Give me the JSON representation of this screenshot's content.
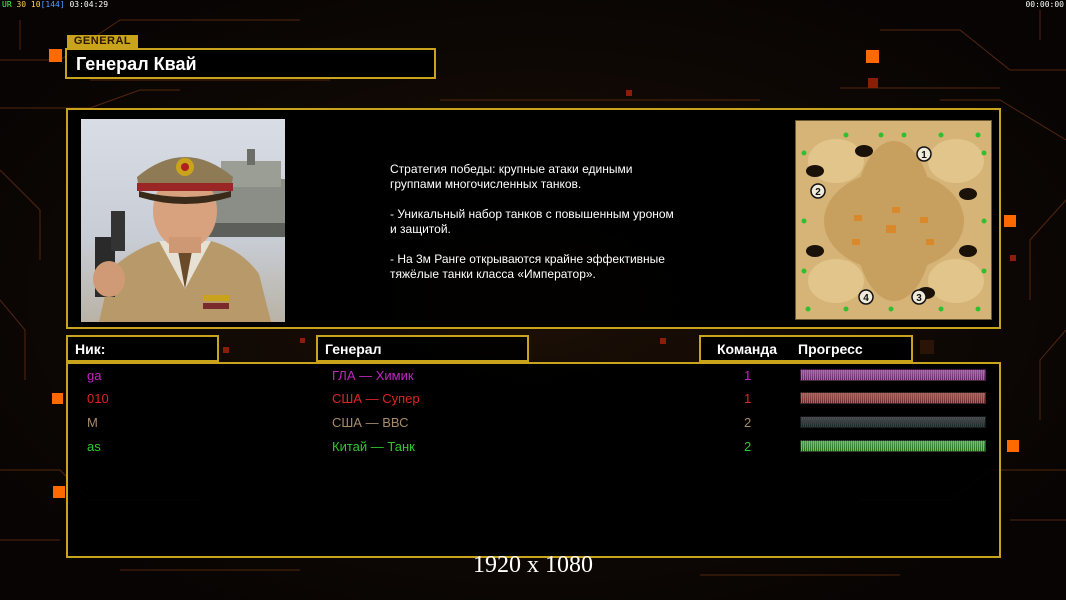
{
  "hud": {
    "fps_label": "UR",
    "fps_values": "30 10",
    "fps_bracket": "[144]",
    "clock": "03:04:29",
    "timer": "00:00:00"
  },
  "general": {
    "tag": "GENERAL",
    "name": "Генерал Квай",
    "description": "Стратегия победы: крупные атаки едиными\n группами многочисленных танков.\n\n- Уникальный набор танков с повышенным уроном\n и защитой.\n\n- На 3м Ранге открываются крайне эффективные\n тяжёлые танки класса «Император»."
  },
  "minimap": {
    "spawns": [
      "1",
      "2",
      "3",
      "4"
    ]
  },
  "headers": {
    "nick": "Ник:",
    "general": "Генерал",
    "team": "Команда",
    "progress": "Прогресс"
  },
  "players": [
    {
      "nick": "ga",
      "general": "ГЛА — Химик",
      "team": "1",
      "color": "#c027c0",
      "progress": 1.0
    },
    {
      "nick": "010",
      "general": "США — Супер",
      "team": "1",
      "color": "#e02424",
      "progress": 1.0
    },
    {
      "nick": "M",
      "general": "США — ВВС",
      "team": "2",
      "color": "#a88a6a",
      "progress": 1.0
    },
    {
      "nick": "as",
      "general": "Китай — Танк",
      "team": "2",
      "color": "#2ec82e",
      "progress": 1.0
    }
  ],
  "bar_colors": [
    "#d44ad4",
    "#e05050",
    "#334444",
    "#40e040"
  ],
  "resolution": "1920 x 1080",
  "theme": {
    "accent": "#c9a31c",
    "orange": "#ff6a00"
  }
}
